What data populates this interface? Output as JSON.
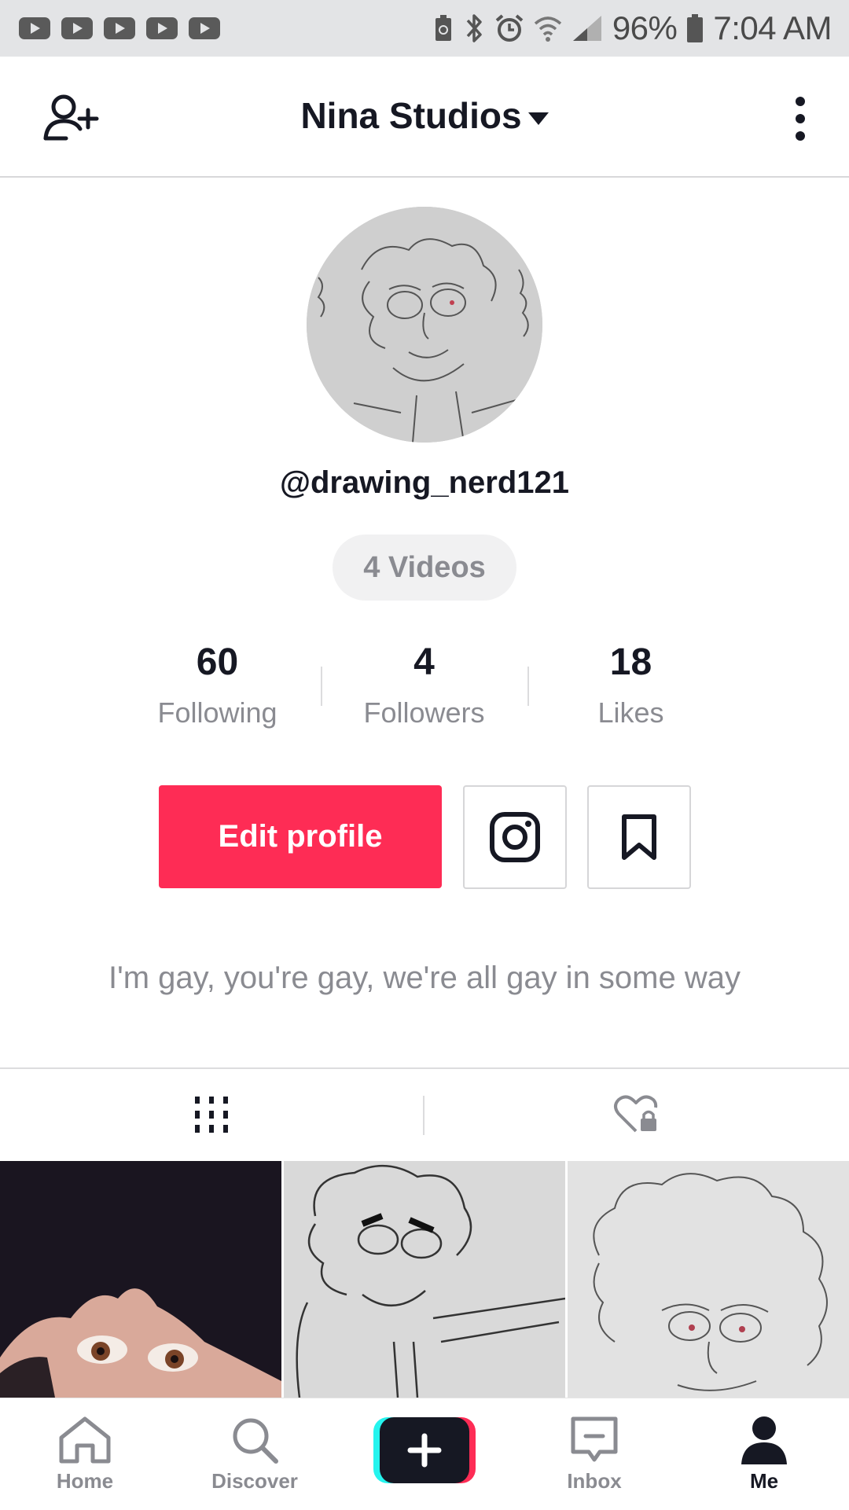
{
  "status_bar": {
    "battery": "96%",
    "time": "7:04 AM",
    "notification_icons": [
      "youtube-icon",
      "youtube-icon",
      "youtube-icon",
      "youtube-icon",
      "youtube-icon"
    ]
  },
  "header": {
    "title": "Nina Studios"
  },
  "profile": {
    "username": "@drawing_nerd121",
    "videos_label": "4 Videos",
    "stats": [
      {
        "value": "60",
        "label": "Following"
      },
      {
        "value": "4",
        "label": "Followers"
      },
      {
        "value": "18",
        "label": "Likes"
      }
    ],
    "edit_label": "Edit profile",
    "bio": "I'm gay, you're gay, we're all gay in some way"
  },
  "bottom_nav": {
    "home": "Home",
    "discover": "Discover",
    "inbox": "Inbox",
    "me": "Me"
  },
  "colors": {
    "accent": "#fe2c55",
    "text": "#161823",
    "muted": "#8a8b91"
  }
}
